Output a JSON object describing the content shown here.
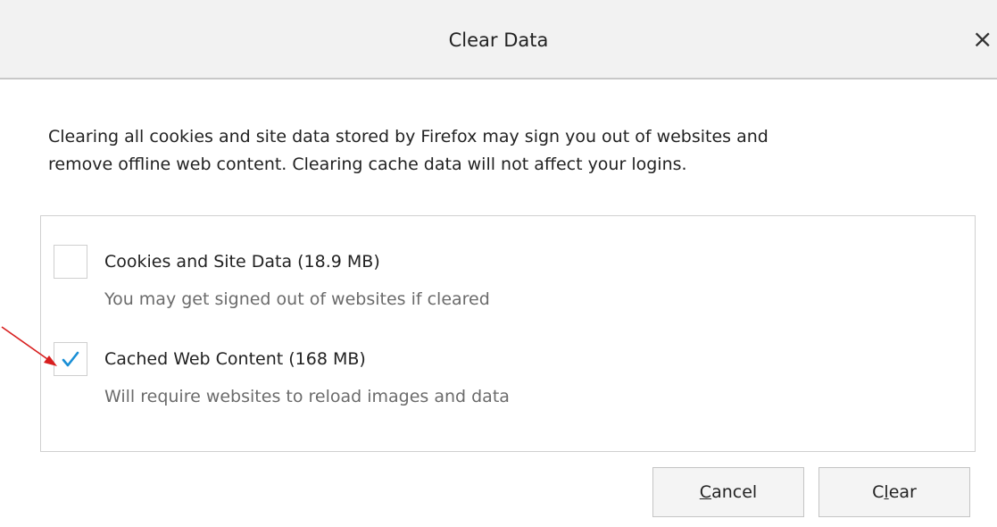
{
  "dialog": {
    "title": "Clear Data",
    "close_symbol": "×",
    "description": "Clearing all cookies and site data stored by Firefox may sign you out of websites and\nremove offline web content. Clearing cache data will not affect your logins."
  },
  "options": [
    {
      "label": "Cookies and Site Data (18.9 MB)",
      "description": "You may get signed out of websites if cleared",
      "checked": false
    },
    {
      "label": "Cached Web Content (168 MB)",
      "description": "Will require websites to reload images and data",
      "checked": true
    }
  ],
  "buttons": {
    "cancel": {
      "prefix": "",
      "accesskey": "C",
      "suffix": "ancel"
    },
    "clear": {
      "prefix": "C",
      "accesskey": "l",
      "suffix": "ear"
    }
  },
  "icons": {
    "close": "close-icon",
    "check": "checkmark-icon",
    "annotation": "red-arrow-icon"
  },
  "colors": {
    "check": "#1a8fd6",
    "annotation_arrow": "#d81e1e",
    "titlebar_bg": "#f2f2f2"
  }
}
